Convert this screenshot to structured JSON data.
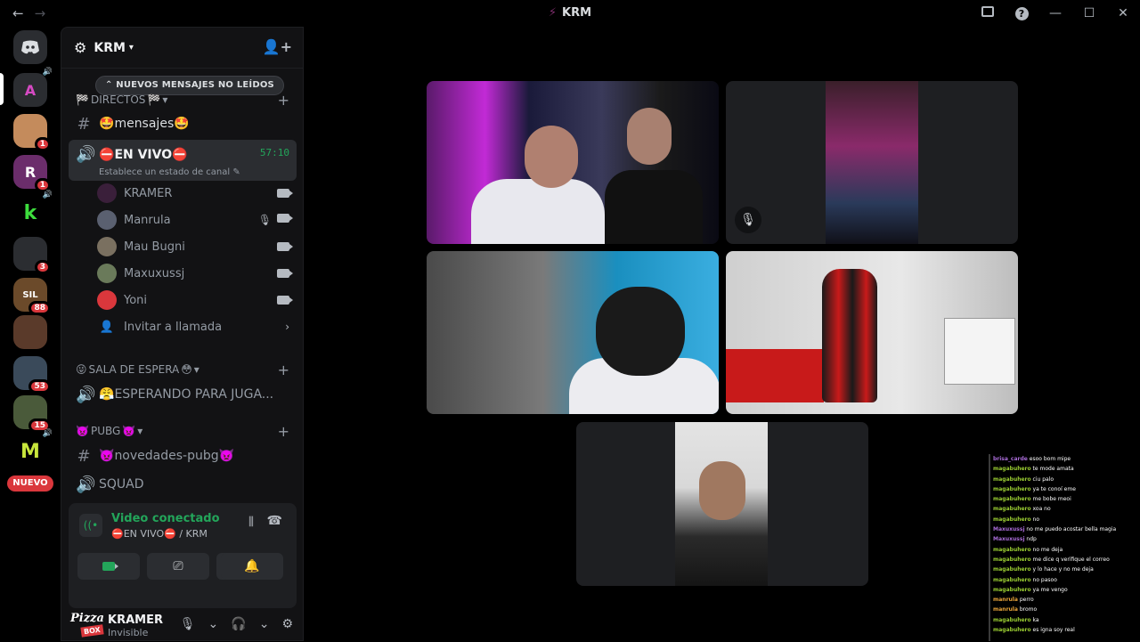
{
  "window": {
    "title": "KRM"
  },
  "servers": [
    {
      "label": "A",
      "color": "#2b2d31",
      "badge": ""
    },
    {
      "label": "",
      "color": "#c48b5c",
      "badge": "1"
    },
    {
      "label": "R",
      "color": "#6b2d6b",
      "badge": "1"
    },
    {
      "label": "k",
      "color": "#000000",
      "badge": ""
    },
    {
      "label": "",
      "color": "#2b2d31",
      "badge": "3"
    },
    {
      "label": "SIL",
      "color": "#6b4a2a",
      "badge": "88"
    },
    {
      "label": "",
      "color": "#5a3a2a",
      "badge": ""
    },
    {
      "label": "",
      "color": "#3a4a5a",
      "badge": "53"
    },
    {
      "label": "",
      "color": "#4a5a3a",
      "badge": "15"
    },
    {
      "label": "M",
      "color": "#000000",
      "badge": ""
    }
  ],
  "nuevo_label": "NUEVO",
  "guild": {
    "name": "KRM"
  },
  "unread_pill": "NUEVOS MENSAJES NO LEÍDOS",
  "categories": {
    "directos": "DIRECTOS",
    "sala": "SALA DE ESPERA",
    "pubg": "PUBG"
  },
  "channels": {
    "mensajes": "mensajes",
    "en_vivo": "EN VIVO",
    "en_vivo_status": "Establece un estado de canal",
    "en_vivo_timer": "57:10",
    "esperando": "ESPERANDO PARA JUGA...",
    "novedades": "novedades-pubg",
    "squad": "SQUAD"
  },
  "members": [
    {
      "name": "KRAMER",
      "avatar": "#3a1f3a"
    },
    {
      "name": "Manrula",
      "avatar": "#5a6070"
    },
    {
      "name": "Mau Bugni",
      "avatar": "#7a7060"
    },
    {
      "name": "Maxuxussj",
      "avatar": "#6a7a5a"
    },
    {
      "name": "Yoni",
      "avatar": "#da373c"
    }
  ],
  "invite_label": "Invitar a llamada",
  "voice_panel": {
    "title": "Video conectado",
    "subtitle": "EN VIVO",
    "guild": "/ KRM"
  },
  "user": {
    "name": "KRAMER",
    "status": "Invisible",
    "logo_top": "Pizza",
    "logo_bottom": "BOX"
  },
  "chat_lines": [
    {
      "user": "brisa_carde",
      "msg": "esoo bom mipe",
      "color": "#a86bd6"
    },
    {
      "user": "magabuhero",
      "msg": "te mode amata",
      "color": "#9acd32"
    },
    {
      "user": "magabuhero",
      "msg": "ciu palo",
      "color": "#9acd32"
    },
    {
      "user": "magabuhero",
      "msg": "ya te conoí eme",
      "color": "#9acd32"
    },
    {
      "user": "magabuhero",
      "msg": "me bobe meoi",
      "color": "#9acd32"
    },
    {
      "user": "magabuhero",
      "msg": "xoa no",
      "color": "#9acd32"
    },
    {
      "user": "magabuhero",
      "msg": "no",
      "color": "#9acd32"
    },
    {
      "user": "Maxuxussj",
      "msg": "no me puedo acostar bella magia",
      "color": "#a86bd6"
    },
    {
      "user": "Maxuxussj",
      "msg": "ndp",
      "color": "#a86bd6"
    },
    {
      "user": "magabuhero",
      "msg": "no me deja",
      "color": "#9acd32"
    },
    {
      "user": "magabuhero",
      "msg": "me dice q verifique el correo",
      "color": "#9acd32"
    },
    {
      "user": "magabuhero",
      "msg": "y lo hace y no me deja",
      "color": "#9acd32"
    },
    {
      "user": "magabuhero",
      "msg": "no pasoo",
      "color": "#9acd32"
    },
    {
      "user": "magabuhero",
      "msg": "ya me vengo",
      "color": "#9acd32"
    },
    {
      "user": "manrula",
      "msg": "perro",
      "color": "#e8a33a"
    },
    {
      "user": "manrula",
      "msg": "bromo",
      "color": "#e8a33a"
    },
    {
      "user": "magabuhero",
      "msg": "ka",
      "color": "#9acd32"
    },
    {
      "user": "magabuhero",
      "msg": "es igna soy real",
      "color": "#9acd32"
    }
  ]
}
